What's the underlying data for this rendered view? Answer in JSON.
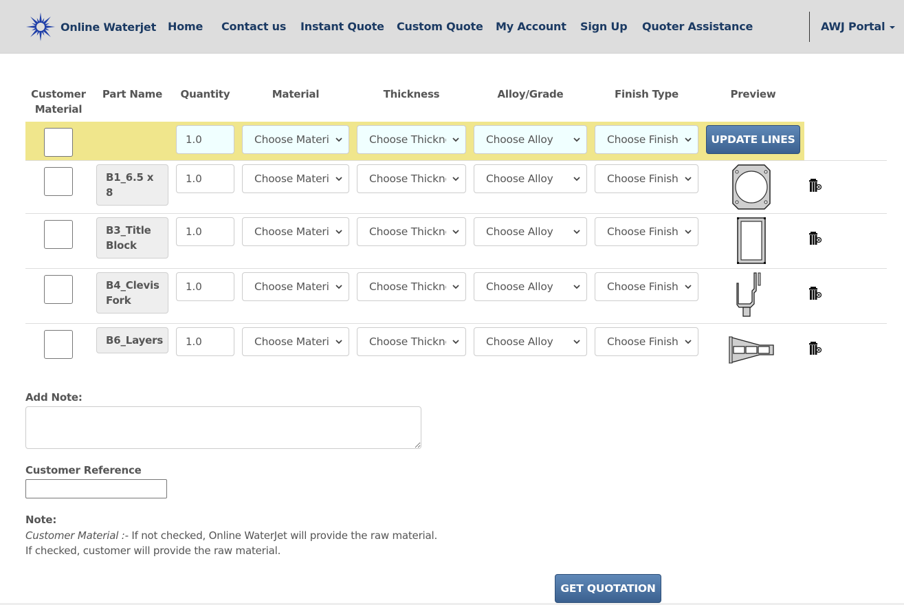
{
  "navbar": {
    "brand": "Online Waterjet",
    "brand_color": "#1b3a63",
    "logo_icon": "starburst-logo-icon",
    "items": [
      {
        "label": "Home"
      },
      {
        "label": "Contact us"
      },
      {
        "label": "Instant Quote"
      },
      {
        "label": "Custom Quote"
      },
      {
        "label": "My Account"
      },
      {
        "label": "Sign Up"
      },
      {
        "label": "Quoter Assistance"
      }
    ],
    "portal_label": "AWJ Portal"
  },
  "table": {
    "headers": {
      "customer_material": "Customer Material",
      "part_name": "Part Name",
      "quantity": "Quantity",
      "material": "Material",
      "thickness": "Thickness",
      "alloy": "Alloy/Grade",
      "finish": "Finish Type",
      "preview": "Preview"
    },
    "update_row": {
      "quantity": "1.0",
      "material": "Choose Material",
      "thickness": "Choose Thickness",
      "alloy": "Choose Alloy",
      "finish": "Choose Finish",
      "update_button": "UPDATE LINES",
      "highlight_color": "#f0e68c"
    },
    "rows": [
      {
        "part_name": "B1_6.5 x 8",
        "quantity": "1.0",
        "material": "Choose Material",
        "thickness": "Choose Thickness",
        "alloy": "Choose Alloy",
        "finish": "Choose Finish",
        "preview": "bracket-plate-preview"
      },
      {
        "part_name": "B3_Title Block",
        "quantity": "1.0",
        "material": "Choose Material",
        "thickness": "Choose Thickness",
        "alloy": "Choose Alloy",
        "finish": "Choose Finish",
        "preview": "frame-preview"
      },
      {
        "part_name": "B4_Clevis Fork",
        "quantity": "1.0",
        "material": "Choose Material",
        "thickness": "Choose Thickness",
        "alloy": "Choose Alloy",
        "finish": "Choose Finish",
        "preview": "clevis-preview"
      },
      {
        "part_name": "B6_Layers",
        "quantity": "1.0",
        "material": "Choose Material",
        "thickness": "Choose Thickness",
        "alloy": "Choose Alloy",
        "finish": "Choose Finish",
        "preview": "layers-preview"
      }
    ]
  },
  "notes": {
    "add_note_label": "Add Note:",
    "add_note_value": "",
    "customer_reference_label": "Customer Reference",
    "customer_reference_value": "",
    "note_heading": "Note:",
    "note_italic": "Customer Material :-",
    "note_line1": " If not checked, Online WaterJet will provide the raw material.",
    "note_line2": "If checked, customer will provide the raw material."
  },
  "actions": {
    "get_quotation": "GET QUOTATION",
    "button_color": "#3b6190"
  }
}
